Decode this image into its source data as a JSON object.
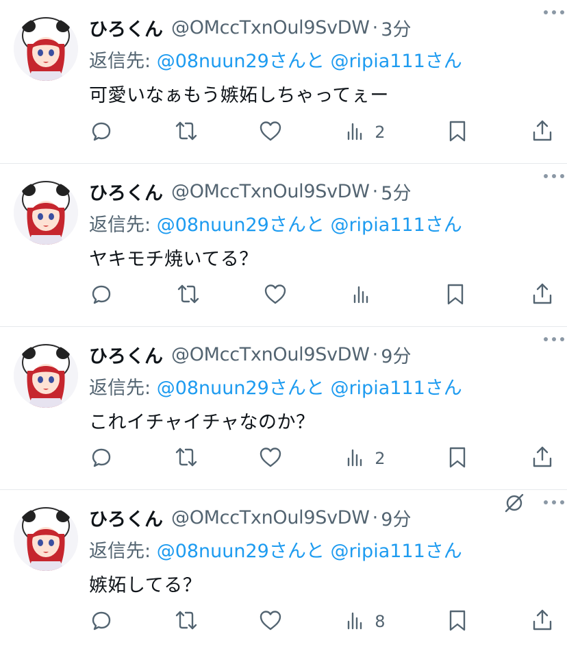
{
  "tweets": [
    {
      "name": "ひろくん",
      "handle": "@OMccTxnOul9SvDW",
      "sep": "·",
      "time": "3分",
      "reply_prefix": "返信先: ",
      "reply_user1": "@08nuun29",
      "reply_mid": "さんと",
      "reply_user2": "@ripia111",
      "reply_suffix": "さん",
      "text": "可愛いなぁもう嫉妬しちゃってぇー",
      "views": "2"
    },
    {
      "name": "ひろくん",
      "handle": "@OMccTxnOul9SvDW",
      "sep": "·",
      "time": "5分",
      "reply_prefix": "返信先: ",
      "reply_user1": "@08nuun29",
      "reply_mid": "さんと",
      "reply_user2": "@ripia111",
      "reply_suffix": "さん",
      "text": "ヤキモチ焼いてる？",
      "views": ""
    },
    {
      "name": "ひろくん",
      "handle": "@OMccTxnOul9SvDW",
      "sep": "·",
      "time": "9分",
      "reply_prefix": "返信先: ",
      "reply_user1": "@08nuun29",
      "reply_mid": "さんと",
      "reply_user2": "@ripia111",
      "reply_suffix": "さん",
      "text": "これイチャイチャなのか？",
      "views": "2"
    },
    {
      "name": "ひろくん",
      "handle": "@OMccTxnOul9SvDW",
      "sep": "·",
      "time": "9分",
      "reply_prefix": "返信先: ",
      "reply_user1": "@08nuun29",
      "reply_mid": "さんと",
      "reply_user2": "@ripia111",
      "reply_suffix": "さん",
      "text": "嫉妬してる？",
      "views": "8"
    }
  ],
  "icons": [
    "avatar",
    "more-dots-icon",
    "unpin-icon",
    "reply-icon",
    "retweet-icon",
    "like-icon",
    "views-icon",
    "bookmark-icon",
    "share-icon"
  ],
  "colors": {
    "link": "#1d9bf0",
    "secondary": "#536471",
    "text": "#0f1419",
    "divider": "#e6e9ec"
  }
}
